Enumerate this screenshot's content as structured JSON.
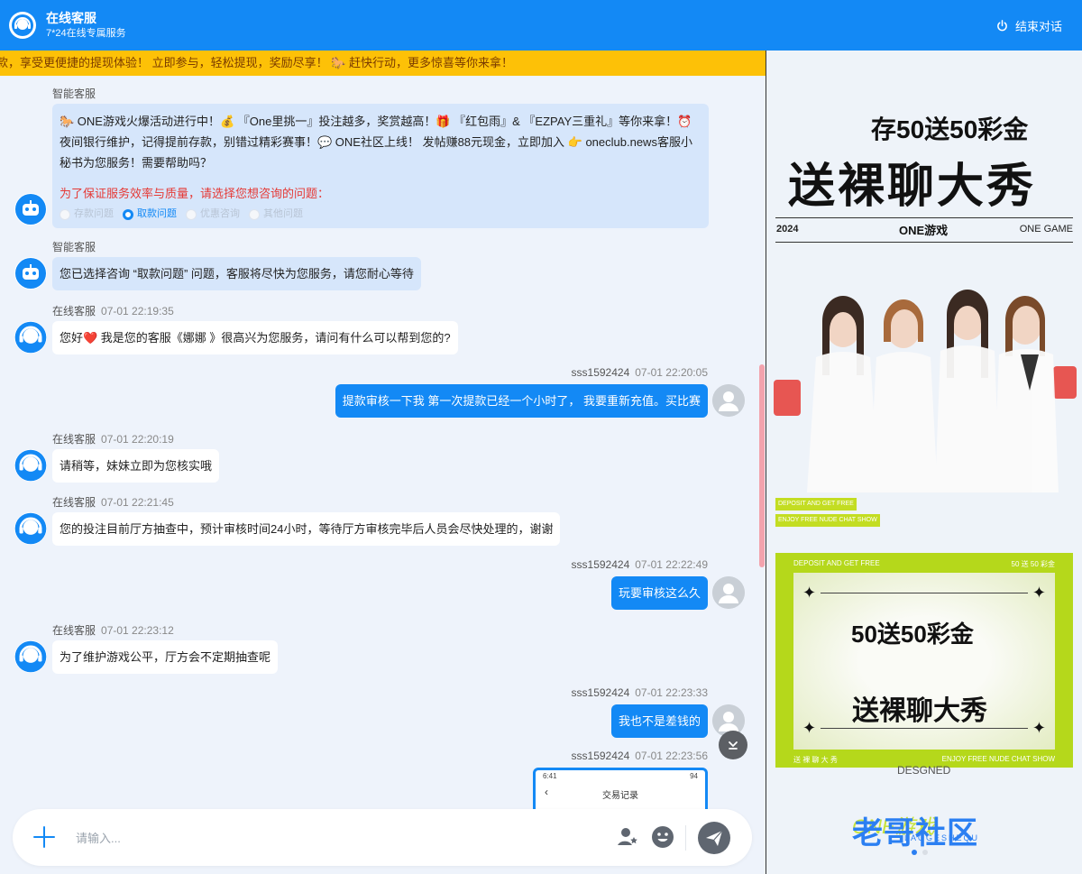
{
  "header": {
    "title": "在线客服",
    "subtitle": "7*24在线专属服务",
    "end_chat": "结束对话"
  },
  "marquee": {
    "text": "款，享受更便捷的提现体验！ 立即参与，轻松提现，奖励尽享！ 🐎 赶快行动，更多惊喜等你来拿！"
  },
  "welcome": {
    "sender": "智能客服",
    "body": "🐎 ONE游戏火爆活动进行中！💰 『One里挑一』投注越多，奖赏越高！🎁 『红包雨』& 『EZPAY三重礼』等你来拿！⏰ 夜间银行维护，记得提前存款，别错过精彩赛事！💬 ONE社区上线！ 发帖赚88元现金，立即加入 👉 oneclub.news客服小秘书为您服务！需要帮助吗？",
    "prompt": "为了保证服务效率与质量，请选择您想咨询的问题：",
    "options": [
      "存款问题",
      "取款问题",
      "优惠咨询",
      "其他问题"
    ],
    "selected_option": "取款问题"
  },
  "messages": [
    {
      "sender": "智能客服",
      "time": "",
      "text": "您已选择咨询 “取款问题” 问题，客服将尽快为您服务，请您耐心等待"
    },
    {
      "sender": "在线客服",
      "time": "07-01 22:19:35",
      "text": "您好❤️ 我是您的客服《娜娜 》很高兴为您服务，请问有什么可以帮到您的?"
    },
    {
      "sender": "sss1592424",
      "time": "07-01 22:20:05",
      "text": "提款审核一下我 第一次提款已经一个小时了， 我要重新充值。买比赛"
    },
    {
      "sender": "在线客服",
      "time": "07-01 22:20:19",
      "text": "请稍等，妹妹立即为您核实哦"
    },
    {
      "sender": "在线客服",
      "time": "07-01 22:21:45",
      "text": "您的投注目前厅方抽查中，预计审核时间24小时，等待厅方审核完毕后人员会尽快处理的，谢谢"
    },
    {
      "sender": "sss1592424",
      "time": "07-01 22:22:49",
      "text": "玩要审核这么久"
    },
    {
      "sender": "在线客服",
      "time": "07-01 22:23:12",
      "text": "为了维护游戏公平，厅方会不定期抽查呢"
    },
    {
      "sender": "sss1592424",
      "time": "07-01 22:23:33",
      "text": "我也不是差钱的"
    },
    {
      "sender": "sss1592424",
      "time": "07-01 22:23:56",
      "text": ""
    }
  ],
  "attachment": {
    "status_time": "6:41",
    "status_right": "94",
    "title": "交易记录"
  },
  "input": {
    "placeholder": "请输入..."
  },
  "ad": {
    "headline_1": "存50送50彩金",
    "headline_2": "送裸聊大秀",
    "year": "2024",
    "brand": "ONE游戏",
    "brand_en": "ONE GAME",
    "tag_1": "DEPOSIT AND GET FREE",
    "tag_2": "ENJOY FREE NUDE CHAT SHOW",
    "card_top_left": "DEPOSIT AND GET FREE",
    "card_top_right": "50 送 50 彩金",
    "card_line_1": "50送50彩金",
    "card_line_2": "送裸聊大秀",
    "card_bottom_left": "送 裸 聊 大 秀",
    "card_bottom_right": "ENJOY FREE NUDE CHAT SHOW",
    "cut_text": "DESGNED",
    "ghost_text": "ONE游戏",
    "logo_text": "老哥社区",
    "logo_sub": "LAOGESHEQU"
  },
  "colors": {
    "primary": "#1389f5",
    "marquee_bg": "#fdc107",
    "page_bg": "#eef3fb",
    "ad_green": "#b5d81b",
    "alert_red": "#e53935"
  }
}
